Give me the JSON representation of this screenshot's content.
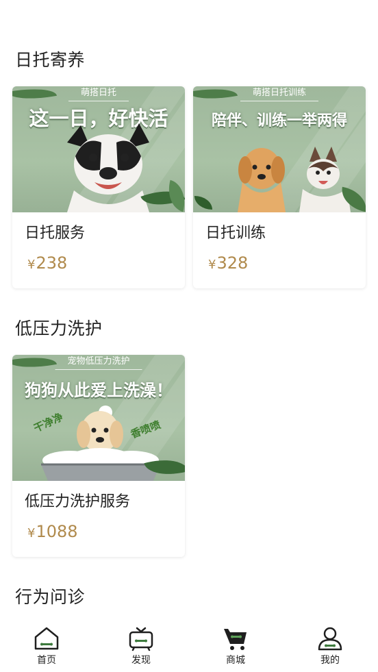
{
  "sections": [
    {
      "title": "日托寄养"
    },
    {
      "title": "低压力洗护"
    },
    {
      "title": "行为问诊"
    }
  ],
  "cards": [
    {
      "tag": "萌搭日托",
      "headline": "这一日，好快活",
      "name": "日托服务",
      "currency": "¥",
      "price": "238"
    },
    {
      "tag": "萌搭日托训练",
      "headline": "陪伴、训练一举两得",
      "name": "日托训练",
      "currency": "¥",
      "price": "328"
    },
    {
      "tag": "宠物低压力洗护",
      "headline": "狗狗从此爱上洗澡！",
      "sub_left": "干净净",
      "sub_right": "香喷喷",
      "name": "低压力洗护服务",
      "currency": "¥",
      "price": "1088"
    }
  ],
  "tabbar": {
    "items": [
      {
        "label": "首页",
        "icon": "home-icon"
      },
      {
        "label": "发现",
        "icon": "tv-icon"
      },
      {
        "label": "商城",
        "icon": "cart-icon"
      },
      {
        "label": "我的",
        "icon": "user-icon"
      }
    ]
  },
  "colors": {
    "accent_green": "#3d7a3d",
    "price": "#b08a4c",
    "card_bg": "#a9c2a5"
  }
}
